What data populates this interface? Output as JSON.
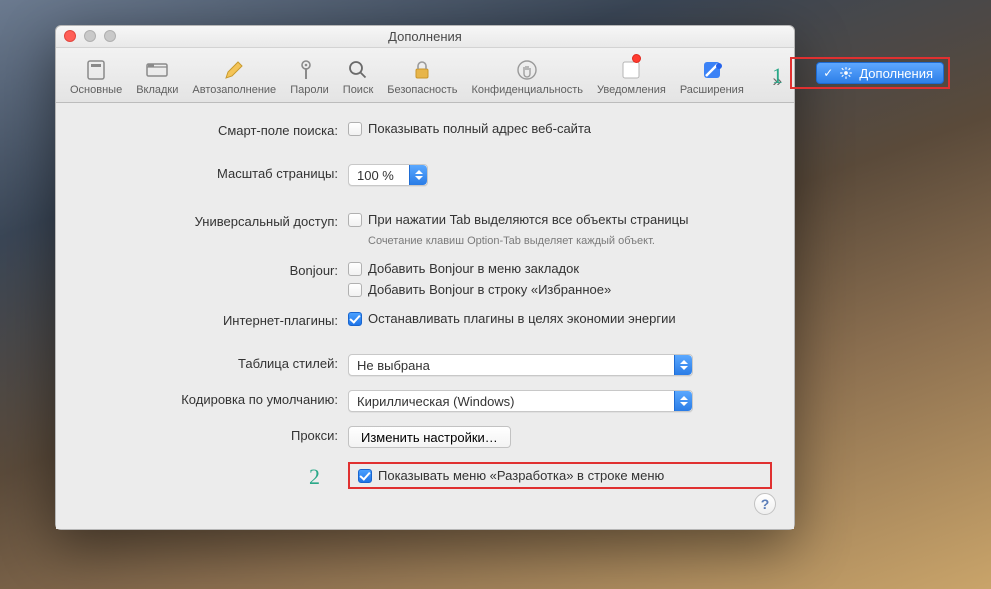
{
  "window": {
    "title": "Дополнения"
  },
  "toolbar": {
    "items": [
      {
        "key": "general",
        "label": "Основные"
      },
      {
        "key": "tabs",
        "label": "Вкладки"
      },
      {
        "key": "autofill",
        "label": "Автозаполнение"
      },
      {
        "key": "passwords",
        "label": "Пароли"
      },
      {
        "key": "search",
        "label": "Поиск"
      },
      {
        "key": "security",
        "label": "Безопасность"
      },
      {
        "key": "privacy",
        "label": "Конфиденциальность"
      },
      {
        "key": "notifications",
        "label": "Уведомления"
      },
      {
        "key": "extensions",
        "label": "Расширения"
      }
    ],
    "overflow_glyph": "»"
  },
  "form": {
    "smart_search": {
      "label": "Смарт-поле поиска:",
      "cb_full_url": "Показывать полный адрес веб-сайта",
      "checked": false
    },
    "page_zoom": {
      "label": "Масштаб страницы:",
      "value": "100 %"
    },
    "universal_access": {
      "label": "Универсальный доступ:",
      "cb_tab": "При нажатии Tab выделяются все объекты страницы",
      "checked": false,
      "hint": "Сочетание клавиш Option-Tab выделяет каждый объект."
    },
    "bonjour": {
      "label": "Bonjour:",
      "cb_bookmarks": "Добавить Bonjour в меню закладок",
      "cb_favorites": "Добавить Bonjour в строку «Избранное»",
      "checked1": false,
      "checked2": false
    },
    "plugins": {
      "label": "Интернет-плагины:",
      "cb_energy": "Останавливать плагины в целях экономии энергии",
      "checked": true
    },
    "stylesheet": {
      "label": "Таблица стилей:",
      "value": "Не выбрана"
    },
    "encoding": {
      "label": "Кодировка по умолчанию:",
      "value": "Кириллическая (Windows)"
    },
    "proxy": {
      "label": "Прокси:",
      "button": "Изменить настройки…"
    },
    "develop_menu": {
      "cb": "Показывать меню «Разработка» в строке меню",
      "checked": true
    }
  },
  "help": {
    "glyph": "?"
  },
  "annotations": {
    "one": "1",
    "two": "2",
    "menu_item": "Дополнения"
  }
}
